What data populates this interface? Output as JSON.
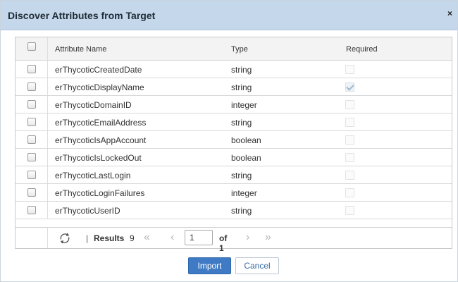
{
  "dialog": {
    "title": "Discover Attributes from Target",
    "close_glyph": "×"
  },
  "grid": {
    "columns": {
      "name": "Attribute Name",
      "type": "Type",
      "required": "Required"
    },
    "rows": [
      {
        "name": "erThycoticCreatedDate",
        "type": "string",
        "required": false
      },
      {
        "name": "erThycoticDisplayName",
        "type": "string",
        "required": true
      },
      {
        "name": "erThycoticDomainID",
        "type": "integer",
        "required": false
      },
      {
        "name": "erThycoticEmailAddress",
        "type": "string",
        "required": false
      },
      {
        "name": "erThycoticIsAppAccount",
        "type": "boolean",
        "required": false
      },
      {
        "name": "erThycoticIsLockedOut",
        "type": "boolean",
        "required": false
      },
      {
        "name": "erThycoticLastLogin",
        "type": "string",
        "required": false
      },
      {
        "name": "erThycoticLoginFailures",
        "type": "integer",
        "required": false
      },
      {
        "name": "erThycoticUserID",
        "type": "string",
        "required": false
      }
    ]
  },
  "pager": {
    "separator": "|",
    "results_label": "Results",
    "results_count": "9",
    "page_value": "1",
    "of_label": "of 1",
    "first_glyph": "«",
    "prev_glyph": "‹",
    "next_glyph": "›",
    "last_glyph": "»"
  },
  "buttons": {
    "import": "Import",
    "cancel": "Cancel"
  }
}
